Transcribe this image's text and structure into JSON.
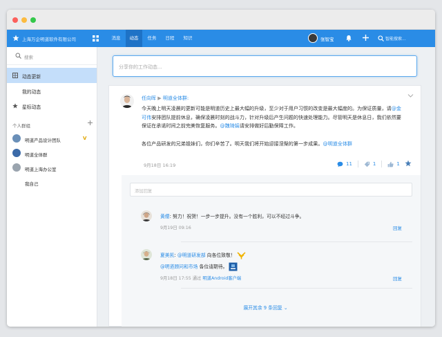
{
  "window": {
    "controls": [
      "close",
      "minimize",
      "zoom"
    ]
  },
  "topnav": {
    "company": "上海万企明道软件有限公司",
    "tabs": [
      {
        "label": "消息",
        "active": false
      },
      {
        "label": "动态",
        "active": true
      },
      {
        "label": "任务",
        "active": false
      },
      {
        "label": "日程",
        "active": false
      },
      {
        "label": "知识",
        "active": false
      }
    ],
    "user_name": "张智宝",
    "search_placeholder": "智能搜索..."
  },
  "sidebar": {
    "search_placeholder": "搜索",
    "items": [
      {
        "label": "动态更新",
        "active": true,
        "icon": "grid-icon"
      },
      {
        "label": "我的动态",
        "active": false,
        "icon": ""
      },
      {
        "label": "星标动态",
        "active": false,
        "icon": "star-icon"
      }
    ],
    "groups_title": "个人群组",
    "groups": [
      {
        "label": "明道产品设计团队",
        "badge": "V"
      },
      {
        "label": "明道全体群",
        "badge": ""
      },
      {
        "label": "明道上海办公室",
        "badge": ""
      },
      {
        "label": "我自己",
        "badge": ""
      }
    ]
  },
  "composer": {
    "placeholder": "分享你的工作动态..."
  },
  "post": {
    "author": "任向晖",
    "separator": "▶",
    "group": "明道全体群:",
    "body": {
      "p1_a": "今天晚上明天凌晨的更新可能是明道历史上最大幅的升级，至少对于用户习惯的改变是最大幅度的。为保证质量，请",
      "m1": "@金可伟",
      "p1_b": "安排团队提前休息，确保凌晨时刻的战斗力，针对升级后产生问题的快速处理能力。尽管明天是休息日，我们依然要保证在承诺时间之前完美恢复服务。",
      "m2": "@魏琦娟",
      "p1_c": "请安排做好后勤保障工作。",
      "p2_a": "各位产品研发的兄弟姐妹们，你们辛苦了。明天我们将开始迎接涅槃的第一步成果。",
      "m3": "@明道全体群"
    },
    "time": "9月18日 16:19",
    "comments_count": "11",
    "tags_count": "1",
    "likes_count": "1",
    "reply_placeholder": "添加回复",
    "comments": [
      {
        "author": "黄缨",
        "text": ": 努力！祝贺！一步一步提升。没有一个胜利，可以不经过斗争。",
        "meta": "9月19日 09:16",
        "reply_label": "回复"
      },
      {
        "author": "夏美凯",
        "text_a": ": ",
        "mention1": "@明道研发部",
        "text_b": " 向各位致敬！",
        "mention2": "@明道顾问和市场",
        "text_c": " 各位请期待。",
        "meta_time": "9月18日 17:55 通过",
        "meta_client": "明道Android客户端",
        "reply_label": "回复"
      }
    ],
    "expand_label": "展开其余 9 条回复 ⌄"
  },
  "colors": {
    "brand": "#2a8ce6",
    "active_tab": "#1e72c6",
    "sidebar_active": "#c4defa"
  }
}
